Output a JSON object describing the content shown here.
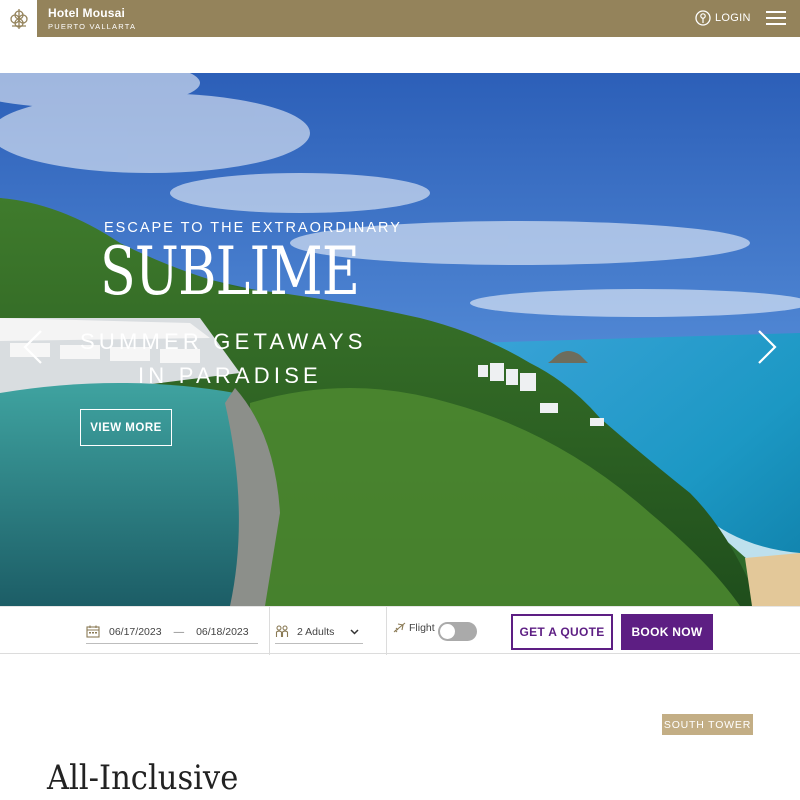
{
  "header": {
    "brand_name": "Hotel Mousai",
    "brand_location": "PUERTO VALLARTA",
    "login_label": "LOGIN",
    "logo_icon": "ornament-logo-icon",
    "menu_icon": "hamburger-menu-icon",
    "background_color": "#94835b"
  },
  "hero": {
    "eyebrow": "ESCAPE TO THE EXTRAORDINARY",
    "headline": "SUBLIME",
    "subline_1": "SUMMER GETAWAYS",
    "subline_2": "IN PARADISE",
    "cta_label": "VIEW MORE",
    "prev_icon": "chevron-left-icon",
    "next_icon": "chevron-right-icon"
  },
  "booking": {
    "check_in": "06/17/2023",
    "date_separator": "—",
    "check_out": "06/18/2023",
    "guests": "2 Adults",
    "flight_label": "Flight",
    "flight_enabled": false,
    "quote_label": "GET A QUOTE",
    "book_label": "BOOK NOW",
    "accent_color": "#5d1e83"
  },
  "section": {
    "badge": "SOUTH TOWER",
    "title": "All-Inclusive"
  }
}
